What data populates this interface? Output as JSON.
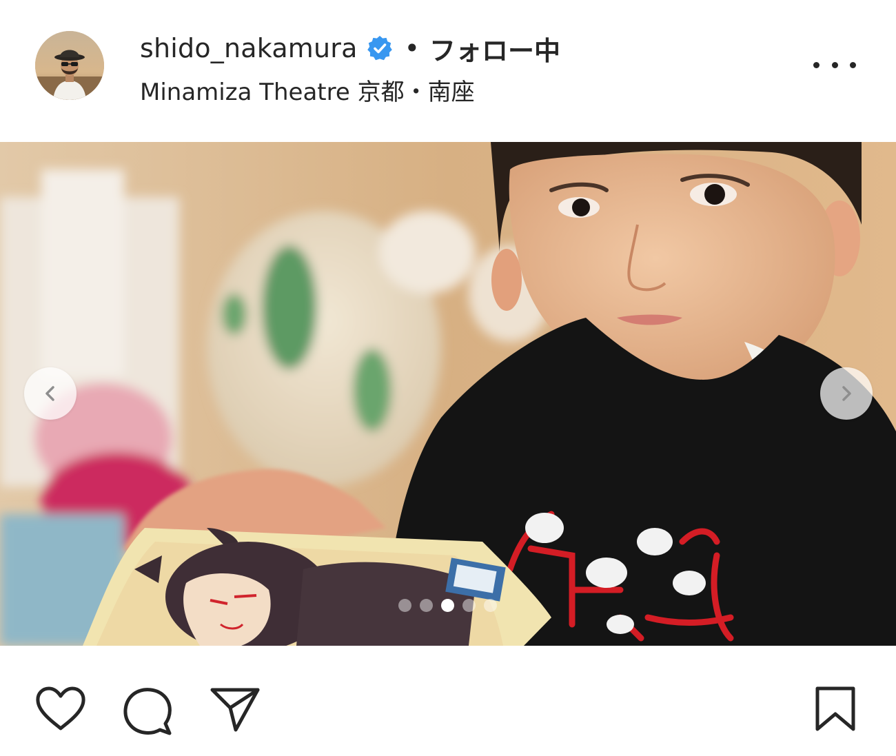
{
  "post": {
    "username": "shido_nakamura",
    "separator": "•",
    "follow_status": "フォロー中",
    "location": "Minamiza Theatre 京都・南座",
    "verified": true,
    "carousel": {
      "current_slide": 3,
      "total_slides": 5
    }
  },
  "icons": {
    "verified": "verified-badge-icon",
    "more": "more-options-icon",
    "prev": "chevron-left-icon",
    "next": "chevron-right-icon",
    "like": "heart-icon",
    "comment": "comment-icon",
    "share": "paper-plane-icon",
    "save": "bookmark-icon"
  },
  "colors": {
    "text": "#262626",
    "verified_blue": "#3897f0",
    "background": "#ffffff"
  }
}
